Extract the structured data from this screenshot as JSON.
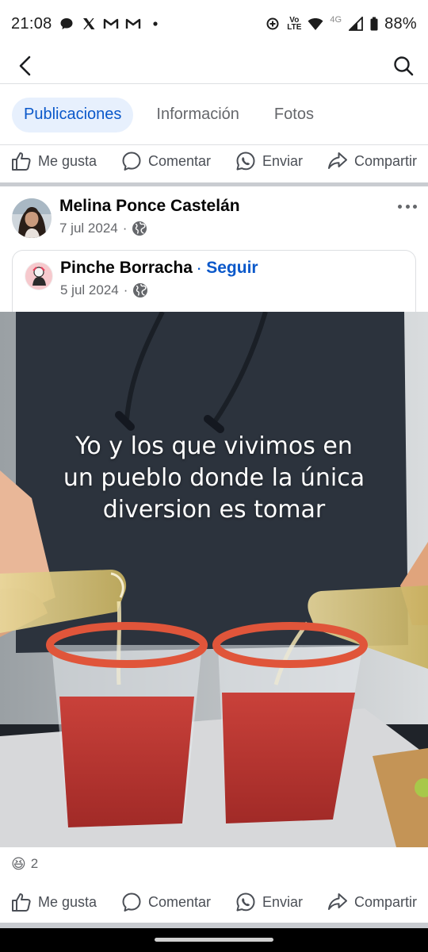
{
  "status_bar": {
    "time": "21:08",
    "notification_icons": [
      "chat-bubble-icon",
      "x-icon",
      "gmail-icon",
      "gmail-icon",
      "dot-icon"
    ],
    "battery": "88%",
    "network_label": "4G",
    "volte_label_top": "Vo",
    "volte_label_bottom": "LTE"
  },
  "nav": {
    "back_icon": "back-arrow-icon",
    "search_icon": "search-icon"
  },
  "tabs": [
    {
      "label": "Publicaciones",
      "active": true
    },
    {
      "label": "Información",
      "active": false
    },
    {
      "label": "Fotos",
      "active": false
    }
  ],
  "actions": {
    "like": "Me gusta",
    "comment": "Comentar",
    "send": "Enviar",
    "share": "Compartir"
  },
  "post": {
    "author": "Melina Ponce Castelán",
    "date": "7 jul 2024",
    "separator": "·",
    "privacy_icon": "globe-icon",
    "shared": {
      "page_name": "Pinche Borracha",
      "separator": "·",
      "follow_label": "Seguir",
      "date": "5 jul 2024"
    },
    "image_caption_lines": [
      "Yo y los que vivimos en",
      "un pueblo donde la única",
      "diversion es tomar"
    ],
    "reaction_emoji": "😆",
    "reaction_count": "2"
  },
  "colors": {
    "accent": "#0a58ca",
    "active_tab_bg": "#e7f0fd",
    "secondary_text": "#65676b",
    "divider": "#c9ccd1"
  }
}
